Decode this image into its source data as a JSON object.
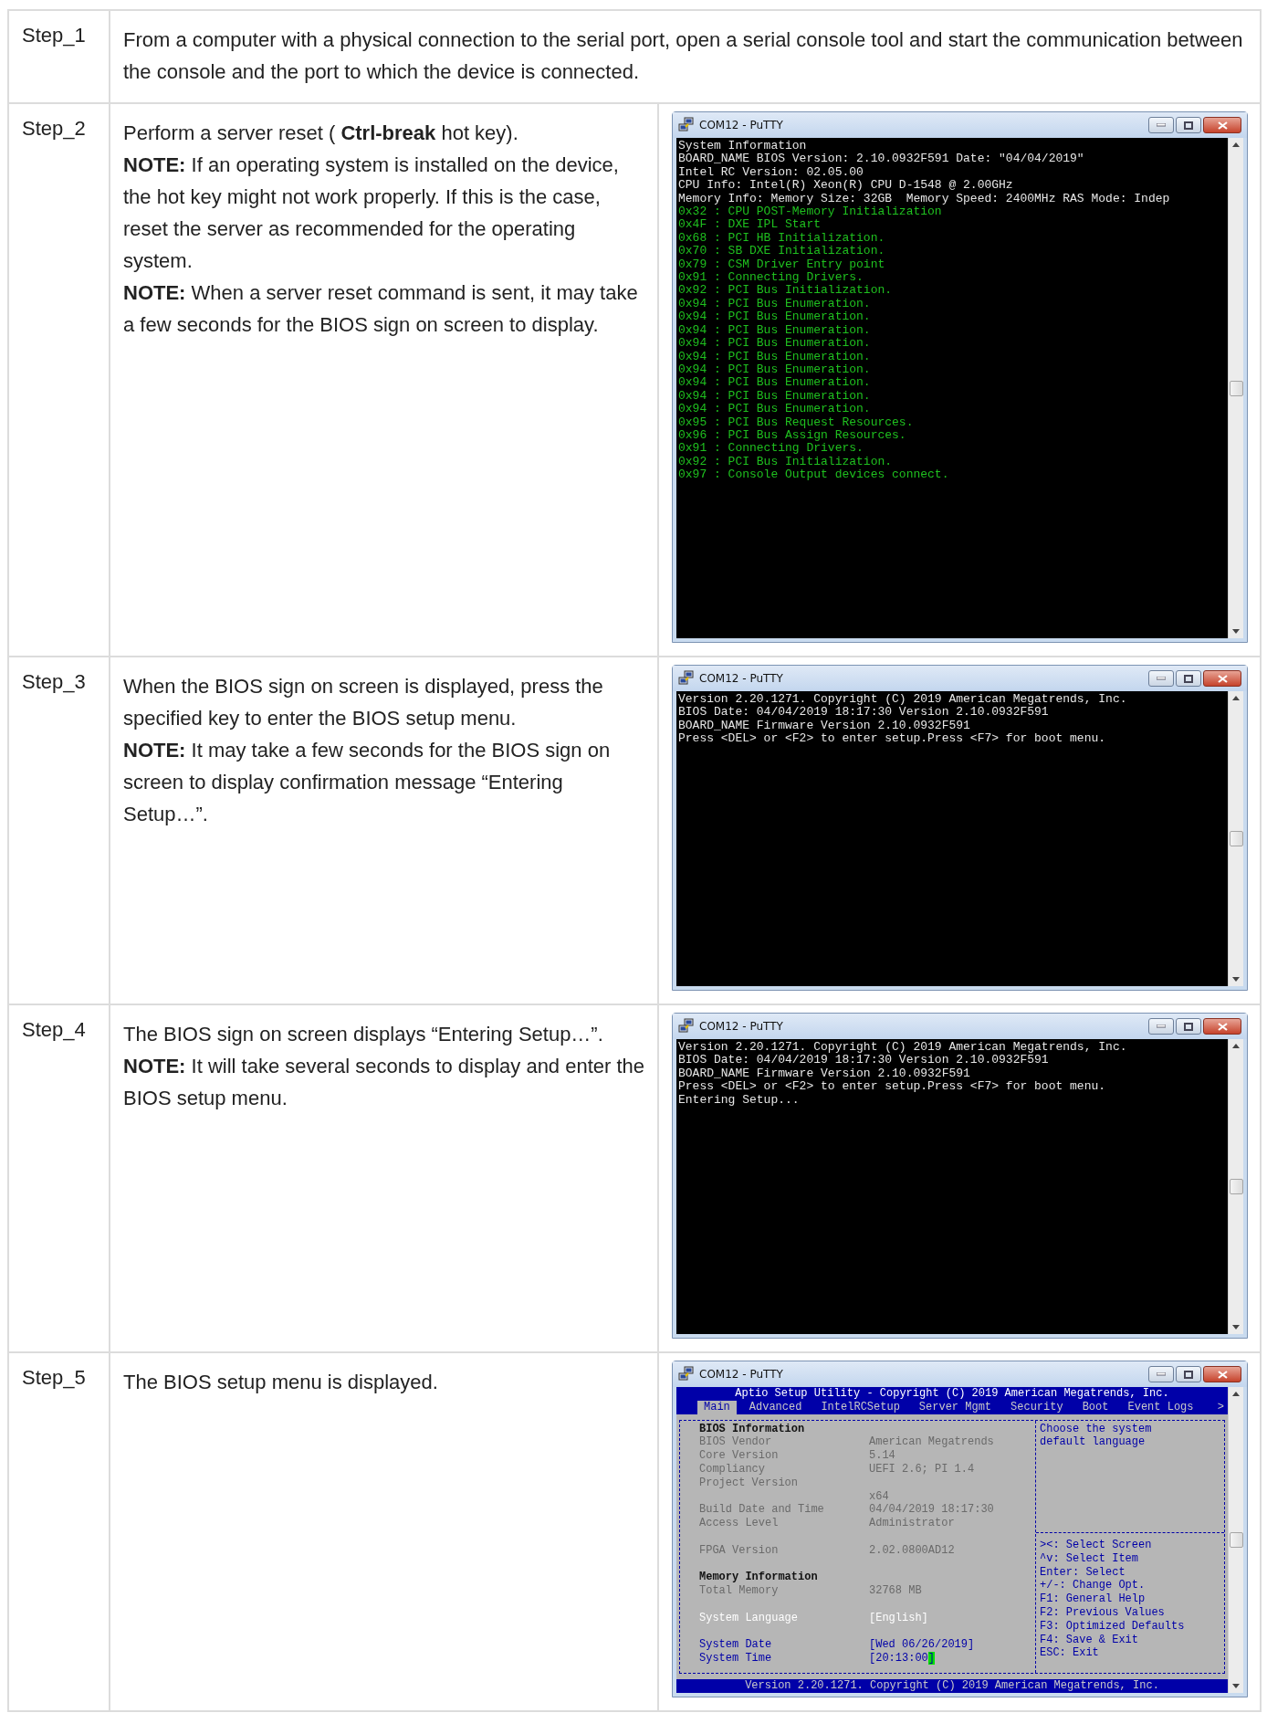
{
  "steps": [
    {
      "label": "Step_1",
      "text": [
        "From a computer with a physical connection to the serial port, open a serial console tool and start the communication between the console and the port to which the device is connected."
      ]
    },
    {
      "label": "Step_2",
      "text": [
        "Perform a server reset ( **Ctrl-break** hot key).",
        "**NOTE:** If an operating system is installed on the device, the hot key might not work properly. If this is the case, reset the server as recommended for the operating system.",
        "**NOTE:** When a server reset command is sent, it may take a few seconds for the BIOS sign on screen to display."
      ],
      "window": {
        "title": "COM12 - PuTTY",
        "screen": {
          "kind": "console",
          "lines": [
            {
              "text": "System Information",
              "color": "#e6e6e6"
            },
            {
              "text": "BOARD_NAME BIOS Version: 2.10.0932F591 Date: \"04/04/2019\"",
              "color": "#e6e6e6"
            },
            {
              "text": "Intel RC Version: 02.05.00",
              "color": "#e6e6e6"
            },
            {
              "text": "CPU Info: Intel(R) Xeon(R) CPU D-1548 @ 2.00GHz",
              "color": "#e6e6e6"
            },
            {
              "text": "Memory Info: Memory Size: 32GB  Memory Speed: 2400MHz RAS Mode: Indep",
              "color": "#e6e6e6"
            },
            {
              "text": "0x32 : CPU POST-Memory Initialization",
              "color": "#1fc01f"
            },
            {
              "text": "0x4F : DXE IPL Start",
              "color": "#1fc01f"
            },
            {
              "text": "0x68 : PCI HB Initialization.",
              "color": "#1fc01f"
            },
            {
              "text": "0x70 : SB DXE Initialization.",
              "color": "#1fc01f"
            },
            {
              "text": "0x79 : CSM Driver Entry point",
              "color": "#1fc01f"
            },
            {
              "text": "0x91 : Connecting Drivers.",
              "color": "#1fc01f"
            },
            {
              "text": "0x92 : PCI Bus Initialization.",
              "color": "#1fc01f"
            },
            {
              "text": "0x94 : PCI Bus Enumeration.",
              "color": "#1fc01f"
            },
            {
              "text": "0x94 : PCI Bus Enumeration.",
              "color": "#1fc01f"
            },
            {
              "text": "0x94 : PCI Bus Enumeration.",
              "color": "#1fc01f"
            },
            {
              "text": "0x94 : PCI Bus Enumeration.",
              "color": "#1fc01f"
            },
            {
              "text": "0x94 : PCI Bus Enumeration.",
              "color": "#1fc01f"
            },
            {
              "text": "0x94 : PCI Bus Enumeration.",
              "color": "#1fc01f"
            },
            {
              "text": "0x94 : PCI Bus Enumeration.",
              "color": "#1fc01f"
            },
            {
              "text": "0x94 : PCI Bus Enumeration.",
              "color": "#1fc01f"
            },
            {
              "text": "0x94 : PCI Bus Enumeration.",
              "color": "#1fc01f"
            },
            {
              "text": "0x95 : PCI Bus Request Resources.",
              "color": "#1fc01f"
            },
            {
              "text": "0x96 : PCI Bus Assign Resources.",
              "color": "#1fc01f"
            },
            {
              "text": "0x91 : Connecting Drivers.",
              "color": "#1fc01f"
            },
            {
              "text": "0x92 : PCI Bus Initialization.",
              "color": "#1fc01f"
            },
            {
              "text": "0x97 : Console Output devices connect.",
              "color": "#1fc01f"
            }
          ]
        }
      }
    },
    {
      "label": "Step_3",
      "text": [
        "When the BIOS sign on screen is displayed, press the specified key to enter the BIOS setup menu.",
        "**NOTE:** It may take a few seconds for the BIOS sign on screen to display confirmation message “Entering Setup…”."
      ],
      "window": {
        "title": "COM12 - PuTTY",
        "screen": {
          "kind": "console",
          "lines": [
            {
              "text": "Version 2.20.1271. Copyright (C) 2019 American Megatrends, Inc.",
              "color": "#e6e6e6"
            },
            {
              "text": "BIOS Date: 04/04/2019 18:17:30 Version 2.10.0932F591",
              "color": "#e6e6e6"
            },
            {
              "text": "BOARD_NAME Firmware Version 2.10.0932F591",
              "color": "#e6e6e6"
            },
            {
              "text": "Press <DEL> or <F2> to enter setup.Press <F7> for boot menu.",
              "color": "#e6e6e6"
            }
          ]
        }
      }
    },
    {
      "label": "Step_4",
      "text": [
        "The BIOS sign on screen displays “Entering Setup…”.",
        "**NOTE:** It will take several seconds to display and enter the BIOS setup menu."
      ],
      "window": {
        "title": "COM12 - PuTTY",
        "screen": {
          "kind": "console",
          "lines": [
            {
              "text": "Version 2.20.1271. Copyright (C) 2019 American Megatrends, Inc.",
              "color": "#e6e6e6"
            },
            {
              "text": "BIOS Date: 04/04/2019 18:17:30 Version 2.10.0932F591",
              "color": "#e6e6e6"
            },
            {
              "text": "BOARD_NAME Firmware Version 2.10.0932F591",
              "color": "#e6e6e6"
            },
            {
              "text": "Press <DEL> or <F2> to enter setup.Press <F7> for boot menu.",
              "color": "#e6e6e6"
            },
            {
              "text": "Entering Setup...",
              "color": "#e6e6e6"
            }
          ]
        }
      }
    },
    {
      "label": "Step_5",
      "text": [
        "The BIOS setup menu is displayed."
      ],
      "window": {
        "title": "COM12 - PuTTY",
        "screen": {
          "kind": "bios",
          "header": "Aptio Setup Utility - Copyright (C) 2019 American Megatrends, Inc.",
          "tabs": [
            {
              "label": "Main",
              "selected": true
            },
            {
              "label": "Advanced",
              "selected": false
            },
            {
              "label": "IntelRCSetup",
              "selected": false
            },
            {
              "label": "Server Mgmt",
              "selected": false
            },
            {
              "label": "Security",
              "selected": false
            },
            {
              "label": "Boot",
              "selected": false
            },
            {
              "label": "Event Logs",
              "selected": false
            }
          ],
          "more_tabs": ">",
          "sections": [
            [
              {
                "kind": "heading",
                "label": "BIOS Information"
              },
              {
                "kind": "info",
                "label": "BIOS Vendor",
                "value": "American Megatrends"
              },
              {
                "kind": "info",
                "label": "Core Version",
                "value": "5.14"
              },
              {
                "kind": "info",
                "label": "Compliancy",
                "value": "UEFI 2.6; PI 1.4"
              },
              {
                "kind": "info",
                "label": "Project Version"
              },
              {
                "kind": "info",
                "value": "x64"
              },
              {
                "kind": "info",
                "label": "Build Date and Time",
                "value": "04/04/2019 18:17:30"
              },
              {
                "kind": "info",
                "label": "Access Level",
                "value": "Administrator"
              }
            ],
            [
              {
                "kind": "info",
                "label": "FPGA Version",
                "value": "2.02.0800AD12"
              }
            ],
            [
              {
                "kind": "heading",
                "label": "Memory Information"
              },
              {
                "kind": "info",
                "label": "Total Memory",
                "value": "32768 MB"
              }
            ],
            [
              {
                "kind": "option",
                "label": "System Language",
                "value": "[English]"
              }
            ],
            [
              {
                "kind": "field",
                "label": "System Date",
                "value": "[Wed 06/26/2019]",
                "cursor": false
              },
              {
                "kind": "field",
                "label": "System Time",
                "value": "[20:13:00]",
                "cursor": true
              }
            ]
          ],
          "help": [
            "Choose the system",
            "default language"
          ],
          "keys": [
            "><: Select Screen",
            "^v: Select Item",
            "Enter: Select",
            "+/-: Change Opt.",
            "F1: General Help",
            "F2: Previous Values",
            "F3: Optimized Defaults",
            "F4: Save & Exit",
            "ESC: Exit"
          ],
          "footer": "Version 2.20.1271. Copyright (C) 2019 American Megatrends, Inc."
        }
      }
    }
  ]
}
